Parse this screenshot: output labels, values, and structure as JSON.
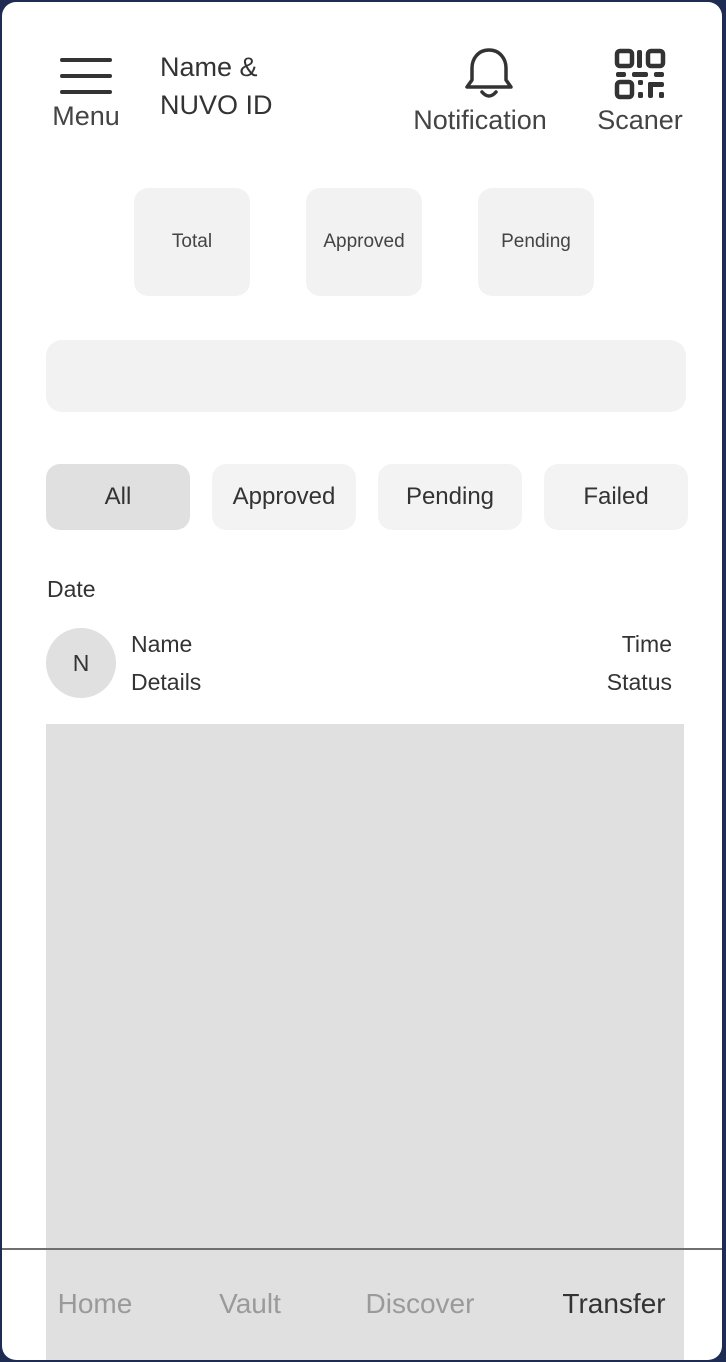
{
  "header": {
    "menu_label": "Menu",
    "name_line1": "Name &",
    "name_line2": "NUVO ID",
    "notification_label": "Notification",
    "scanner_label": "Scaner"
  },
  "stats": {
    "total_label": "Total",
    "approved_label": "Approved",
    "pending_label": "Pending"
  },
  "search": {
    "value": "",
    "placeholder": ""
  },
  "filters": [
    {
      "label": "All",
      "active": true
    },
    {
      "label": "Approved",
      "active": false
    },
    {
      "label": "Pending",
      "active": false
    },
    {
      "label": "Failed",
      "active": false
    }
  ],
  "transactions": {
    "date_label": "Date",
    "row": {
      "avatar_initial": "N",
      "name": "Name",
      "details": "Details",
      "time": "Time",
      "status": "Status"
    }
  },
  "bottom_nav": [
    {
      "label": "Home",
      "active": false
    },
    {
      "label": "Vault",
      "active": false
    },
    {
      "label": "Discover",
      "active": false
    },
    {
      "label": "Transfer",
      "active": true
    }
  ],
  "colors": {
    "frame_border": "#1e2b52",
    "card_bg": "#f2f2f2",
    "active_chip_bg": "#e0e0e0",
    "text": "#333333",
    "inactive_nav": "#9a9a9a"
  }
}
